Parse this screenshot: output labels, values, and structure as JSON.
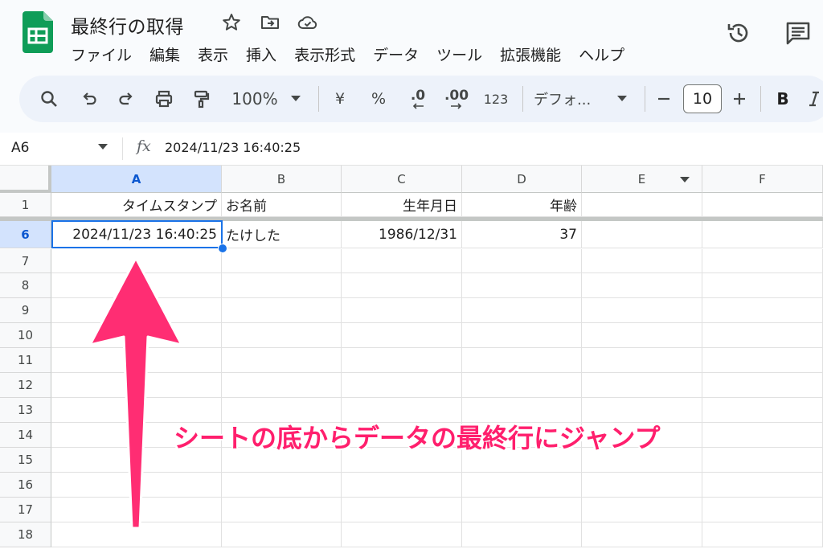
{
  "document": {
    "title": "最終行の取得"
  },
  "menu": [
    "ファイル",
    "編集",
    "表示",
    "挿入",
    "表示形式",
    "データ",
    "ツール",
    "拡張機能",
    "ヘルプ"
  ],
  "toolbar": {
    "zoom": "100%",
    "currency": "¥",
    "percent": "%",
    "decimal_decrease": ".0",
    "decimal_increase": ".00",
    "number_format": "123",
    "font": "デフォ...",
    "font_size": "10",
    "bold": "B"
  },
  "formula_bar": {
    "cell_ref": "A6",
    "fx": "fx",
    "value": "2024/11/23 16:40:25"
  },
  "sheet": {
    "columns": [
      "A",
      "B",
      "C",
      "D",
      "E",
      "F"
    ],
    "selected_column": "A",
    "rows": [
      {
        "num": "1",
        "cells": [
          "タイムスタンプ",
          "お名前",
          "生年月日",
          "年齢",
          "",
          ""
        ]
      },
      {
        "num": "6",
        "cells": [
          "2024/11/23 16:40:25",
          "たけした",
          "1986/12/31",
          "37",
          "",
          ""
        ]
      },
      {
        "num": "7",
        "cells": [
          "",
          "",
          "",
          "",
          "",
          ""
        ]
      },
      {
        "num": "8",
        "cells": [
          "",
          "",
          "",
          "",
          "",
          ""
        ]
      },
      {
        "num": "9",
        "cells": [
          "",
          "",
          "",
          "",
          "",
          ""
        ]
      },
      {
        "num": "10",
        "cells": [
          "",
          "",
          "",
          "",
          "",
          ""
        ]
      },
      {
        "num": "11",
        "cells": [
          "",
          "",
          "",
          "",
          "",
          ""
        ]
      },
      {
        "num": "12",
        "cells": [
          "",
          "",
          "",
          "",
          "",
          ""
        ]
      },
      {
        "num": "13",
        "cells": [
          "",
          "",
          "",
          "",
          "",
          ""
        ]
      },
      {
        "num": "14",
        "cells": [
          "",
          "",
          "",
          "",
          "",
          ""
        ]
      },
      {
        "num": "15",
        "cells": [
          "",
          "",
          "",
          "",
          "",
          ""
        ]
      },
      {
        "num": "16",
        "cells": [
          "",
          "",
          "",
          "",
          "",
          ""
        ]
      },
      {
        "num": "17",
        "cells": [
          "",
          "",
          "",
          "",
          "",
          ""
        ]
      },
      {
        "num": "18",
        "cells": [
          "",
          "",
          "",
          "",
          "",
          ""
        ]
      }
    ],
    "selected_row": "6"
  },
  "annotation": {
    "text": "シートの底からデータの最終行にジャンプ",
    "color": "#ff1f6d"
  },
  "colors": {
    "accent": "#1a73e8",
    "sheets_green": "#0f9d58"
  }
}
